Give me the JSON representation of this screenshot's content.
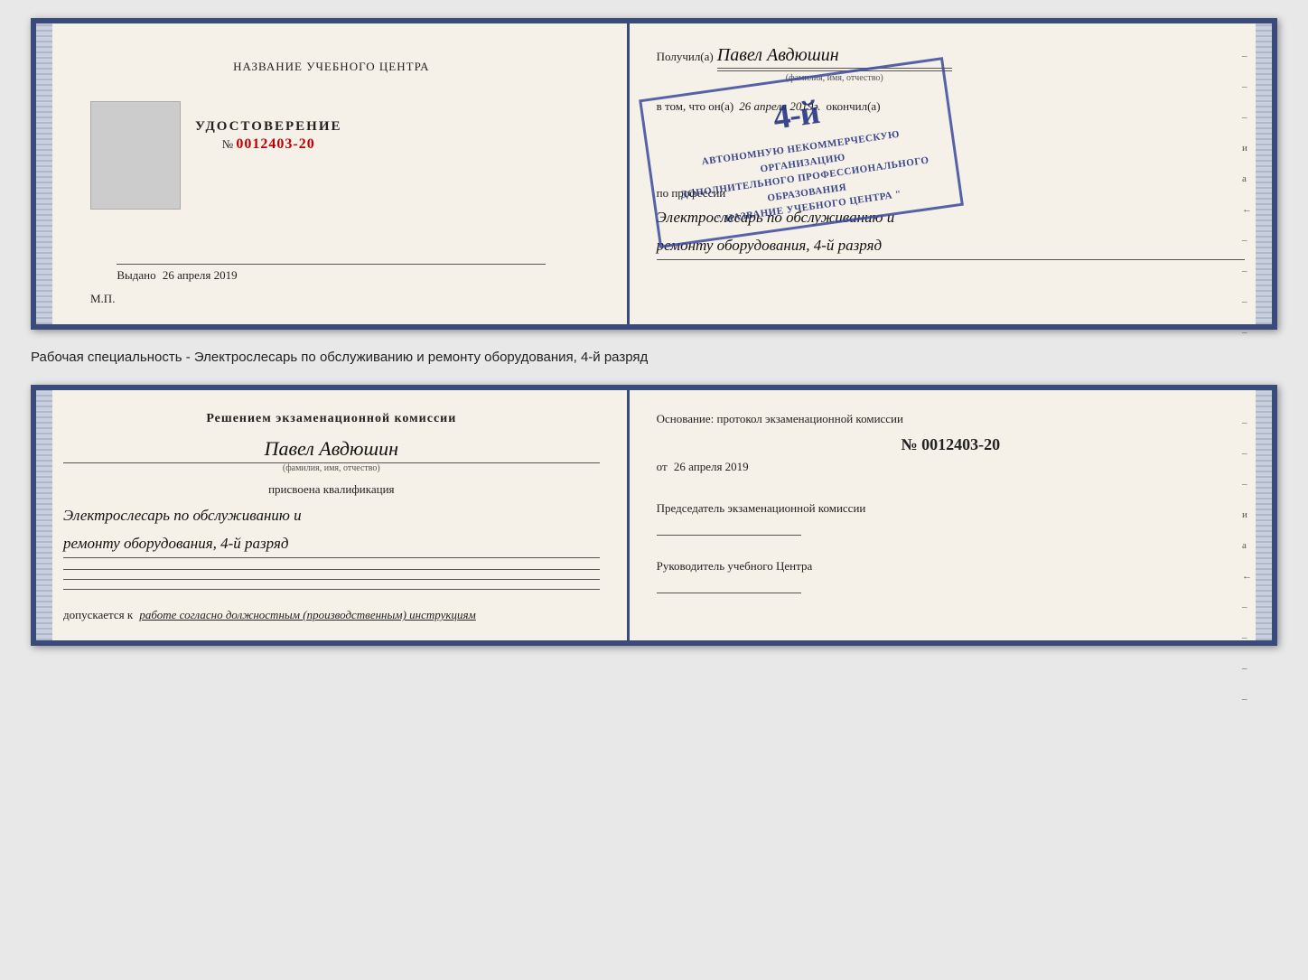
{
  "top_document": {
    "left": {
      "center_title": "НАЗВАНИЕ УЧЕБНОГО ЦЕНТРА",
      "udostoverenie_label": "УДОСТОВЕРЕНИЕ",
      "number_prefix": "№",
      "number_value": "0012403-20",
      "vydano_label": "Выдано",
      "vydano_date": "26 апреля 2019",
      "mp_label": "М.П."
    },
    "right": {
      "received_prefix": "Получил(а)",
      "received_name": "Павел Авдюшин",
      "fio_label": "(фамилия, имя, отчество)",
      "vtom_prefix": "в том, что он(а)",
      "vtom_date": "26 апреля 2019г.",
      "okonchil_label": "окончил(а)",
      "stamp_line1": "АВТОНОМНУЮ НЕКОММЕРЧЕСКУЮ ОРГАНИЗАЦИЮ",
      "stamp_line2": "ДОПОЛНИТЕЛЬНОГО ПРОФЕССИОНАЛЬНОГО ОБРАЗОВАНИЯ",
      "stamp_line3": "\" НАЗВАНИЕ УЧЕБНОГО ЦЕНТРА \"",
      "stamp_rank": "4-й",
      "profession_prefix": "по профессии",
      "profession_name": "Электрослесарь по обслуживанию и",
      "profession_name2": "ремонту оборудования, 4-й разряд"
    }
  },
  "info_text": "Рабочая специальность - Электрослесарь по обслуживанию и ремонту оборудования, 4-й разряд",
  "bottom_document": {
    "left": {
      "commission_title": "Решением экзаменационной комиссии",
      "person_name": "Павел Авдюшин",
      "fio_label": "(фамилия, имя, отчество)",
      "assigned_text": "присвоена квалификация",
      "qualification1": "Электрослесарь по обслуживанию и",
      "qualification2": "ремонту оборудования, 4-й разряд",
      "допускается_prefix": "допускается к",
      "допускается_text": "работе согласно должностным (производственным) инструкциям"
    },
    "right": {
      "osnov_text": "Основание: протокол экзаменационной комиссии",
      "number_prefix": "№",
      "number_value": "0012403-20",
      "ot_prefix": "от",
      "ot_date": "26 апреля 2019",
      "chairman_title": "Председатель экзаменационной комиссии",
      "руководитель_title": "Руководитель учебного Центра"
    }
  },
  "dashes": [
    "-",
    "–",
    "–",
    "–",
    "и",
    "а",
    "←",
    "–",
    "–",
    "–",
    "–"
  ]
}
